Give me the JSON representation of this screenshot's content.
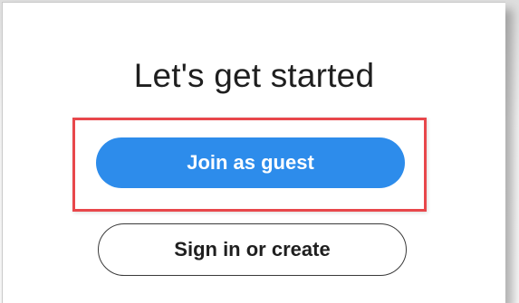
{
  "dialog": {
    "title": "Let's get started",
    "join_guest_label": "Join as guest",
    "sign_in_label": "Sign in or create"
  },
  "colors": {
    "primary_button": "#2d8ceb",
    "highlight_border": "#e8474b"
  }
}
